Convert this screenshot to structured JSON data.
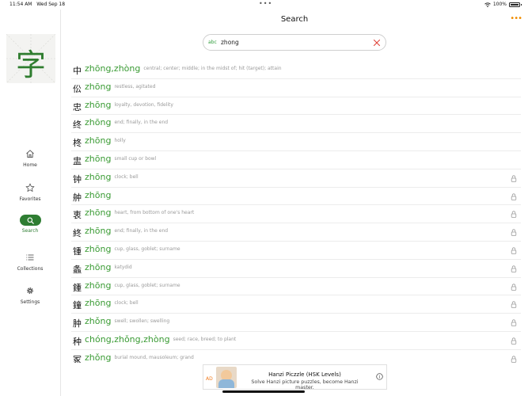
{
  "status": {
    "time": "11:54 AM",
    "date": "Wed Sep 18",
    "battery": "100%"
  },
  "header": {
    "title": "Search"
  },
  "sidebar": {
    "logo_char": "字",
    "items": [
      {
        "label": "Home",
        "icon": "home-icon"
      },
      {
        "label": "Favorites",
        "icon": "star-icon"
      },
      {
        "label": "Search",
        "icon": "search-icon",
        "active": true
      },
      {
        "label": "Collections",
        "icon": "list-icon"
      },
      {
        "label": "Settings",
        "icon": "gear-icon"
      }
    ]
  },
  "search": {
    "mode_label": "abc",
    "value": "zhong"
  },
  "results": [
    {
      "char": "中",
      "pinyin": "zhōng,zhòng",
      "def": "central; center; middle; in the midst of; hit (target); attain",
      "locked": false
    },
    {
      "char": "伀",
      "pinyin": "zhōng",
      "def": "restless, agitated",
      "locked": false
    },
    {
      "char": "忠",
      "pinyin": "zhōng",
      "def": "loyalty, devotion, fidelity",
      "locked": false
    },
    {
      "char": "终",
      "pinyin": "zhōng",
      "def": "end; finally, in the end",
      "locked": false
    },
    {
      "char": "柊",
      "pinyin": "zhōng",
      "def": "holly",
      "locked": false
    },
    {
      "char": "盅",
      "pinyin": "zhōng",
      "def": "small cup or bowl",
      "locked": false
    },
    {
      "char": "钟",
      "pinyin": "zhōng",
      "def": "clock; bell",
      "locked": true
    },
    {
      "char": "舯",
      "pinyin": "zhōng",
      "def": "",
      "locked": true
    },
    {
      "char": "衷",
      "pinyin": "zhōng",
      "def": "heart, from bottom of one's heart",
      "locked": true
    },
    {
      "char": "終",
      "pinyin": "zhōng",
      "def": "end; finally, in the end",
      "locked": true
    },
    {
      "char": "锺",
      "pinyin": "zhōng",
      "def": "cup, glass, goblet; surname",
      "locked": true
    },
    {
      "char": "螽",
      "pinyin": "zhōng",
      "def": "katydid",
      "locked": true
    },
    {
      "char": "鍾",
      "pinyin": "zhōng",
      "def": "cup, glass, goblet; surname",
      "locked": true
    },
    {
      "char": "鐘",
      "pinyin": "zhōng",
      "def": "clock; bell",
      "locked": true
    },
    {
      "char": "肿",
      "pinyin": "zhǒng",
      "def": "swell; swollen; swelling",
      "locked": true
    },
    {
      "char": "种",
      "pinyin": "chóng,zhǒng,zhòng",
      "def": "seed; race, breed; to plant",
      "locked": true
    },
    {
      "char": "冢",
      "pinyin": "zhǒng",
      "def": "burial mound, mausoleum; grand",
      "locked": true
    }
  ],
  "ad": {
    "tag": "AD",
    "title": "Hanzi Piczzle (HSK Levels)",
    "subtitle": "Solve Hanzi picture puzzles, become Hanzi master."
  },
  "colors": {
    "accent": "#2e7d32",
    "pinyin": "#3a9b34",
    "more": "#f08c00",
    "clear": "#e0453a"
  }
}
